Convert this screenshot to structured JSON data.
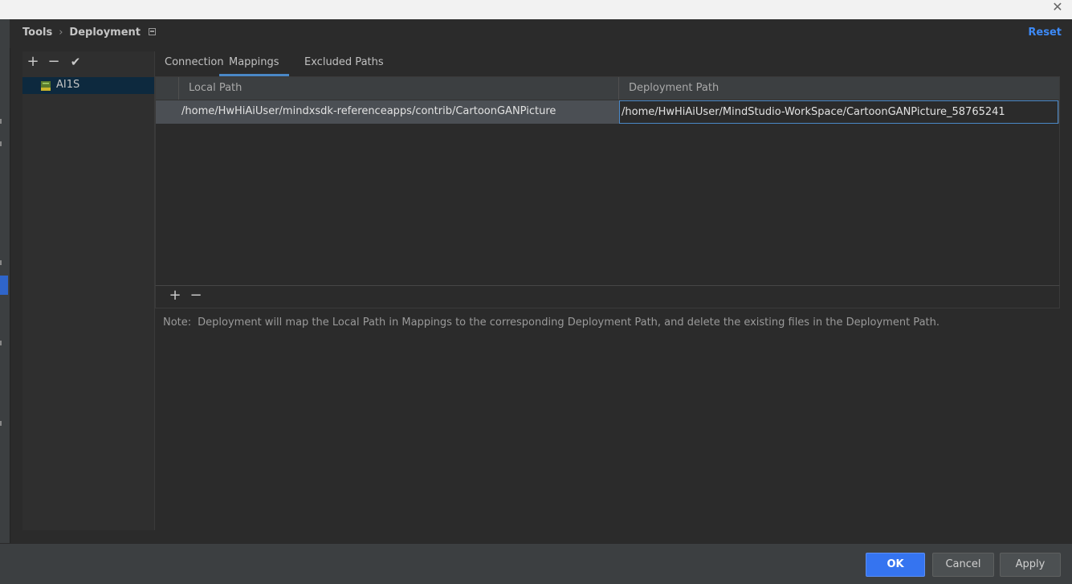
{
  "header": {
    "breadcrumb_root": "Tools",
    "breadcrumb_separator": "›",
    "breadcrumb_current": "Deployment",
    "reset_label": "Reset"
  },
  "window": {
    "close_glyph": "✕"
  },
  "left_panel": {
    "toolbar": {
      "add": "+",
      "remove": "−",
      "check": "✔"
    },
    "servers": [
      {
        "label": "AI1S",
        "icon": "sftp-server-icon"
      }
    ]
  },
  "tabs": [
    {
      "label": "Connection",
      "active": false
    },
    {
      "label": "Mappings",
      "active": true
    },
    {
      "label": "Excluded Paths",
      "active": false
    }
  ],
  "mappings_table": {
    "columns": [
      "Local Path",
      "Deployment Path"
    ],
    "rows": [
      {
        "local_path": "/home/HwHiAiUser/mindxsdk-referenceapps/contrib/CartoonGANPicture",
        "deployment_path": "/home/HwHiAiUser/MindStudio-WorkSpace/CartoonGANPicture_58765241"
      }
    ],
    "toolbar": {
      "add": "+",
      "remove": "−"
    }
  },
  "note": {
    "label": "Note:",
    "text": "Deployment will map the Local Path in Mappings to the corresponding Deployment Path, and delete the existing files in the Deployment Path."
  },
  "footer": {
    "ok_label": "OK",
    "cancel_label": "Cancel",
    "apply_label": "Apply"
  },
  "colors": {
    "accent": "#3574f0",
    "link": "#3d8af7",
    "selected_row": "#4b4f54"
  }
}
